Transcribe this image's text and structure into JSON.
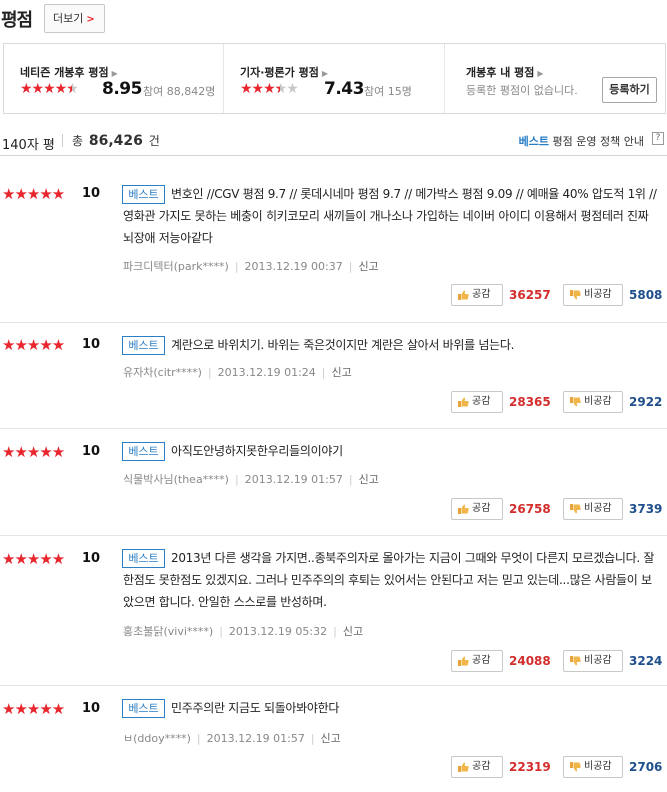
{
  "header": {
    "title": "평점",
    "more_label": "더보기"
  },
  "scores": {
    "netizen": {
      "label": "네티즌 개봉후 평점",
      "score": "8.95",
      "participants": "참여 88,842명",
      "stars": 4.5
    },
    "critic": {
      "label": "기자·평론가 평점",
      "score": "7.43",
      "participants": "참여 15명",
      "stars": 3.5
    },
    "mine": {
      "label": "개봉후 내 평점",
      "none_text": "등록한 평점이 없습니다.",
      "register_label": "등록하기"
    }
  },
  "summary": {
    "count_label": "140자 평",
    "total_prefix": "총",
    "total_value": "86,426",
    "total_suffix": "건",
    "policy_best": "베스트",
    "policy_text": "평점 운영 정책 안내",
    "help": "?"
  },
  "reviews": [
    {
      "score": "10",
      "badge": "베스트",
      "text": "변호인 //CGV 평점 9.7 // 롯데시네마 평점 9.7 // 메가박스 평점 9.09 // 예매율 40% 압도적 1위 // 영화관 가지도 못하는 베충이 히키코모리 새끼들이 개나소나 가입하는 네이버 아이디 이용해서 평점테러 진짜 뇌장애 저능아같다",
      "author": "파크디텍터(park****)",
      "date": "2013.12.19 00:37",
      "report": "신고",
      "like_label": "공감",
      "likes": "36257",
      "dislike_label": "비공감",
      "dislikes": "5808"
    },
    {
      "score": "10",
      "badge": "베스트",
      "text": "계란으로 바위치기. 바위는 죽은것이지만 계란은 살아서 바위를 넘는다.",
      "author": "유자차(citr****)",
      "date": "2013.12.19 01:24",
      "report": "신고",
      "like_label": "공감",
      "likes": "28365",
      "dislike_label": "비공감",
      "dislikes": "2922"
    },
    {
      "score": "10",
      "badge": "베스트",
      "text": "아직도안녕하지못한우리들의이야기",
      "author": "식물박사님(thea****)",
      "date": "2013.12.19 01:57",
      "report": "신고",
      "like_label": "공감",
      "likes": "26758",
      "dislike_label": "비공감",
      "dislikes": "3739"
    },
    {
      "score": "10",
      "badge": "베스트",
      "text": "2013년 다른 생각을 가지면..종북주의자로 몰아가는 지금이 그때와 무엇이 다른지 모르겠습니다. 잘한점도 못한점도 있겠지요. 그러나 민주주의의 후퇴는 있어서는 안된다고 저는 믿고 있는데...많은 사람들이 보았으면 합니다. 안일한 스스로를 반성하며.",
      "author": "홍초불닭(vivi****)",
      "date": "2013.12.19 05:32",
      "report": "신고",
      "like_label": "공감",
      "likes": "24088",
      "dislike_label": "비공감",
      "dislikes": "3224"
    },
    {
      "score": "10",
      "badge": "베스트",
      "text": "민주주의란 지금도 되돌아봐야한다",
      "author": "ㅂ(ddoy****)",
      "date": "2013.12.19 01:57",
      "report": "신고",
      "like_label": "공감",
      "likes": "22319",
      "dislike_label": "비공감",
      "dislikes": "2706"
    }
  ],
  "review_stars": "★★★★★",
  "colors": {
    "accent_red": "#e8262e",
    "best_blue": "#2a7ec6"
  }
}
